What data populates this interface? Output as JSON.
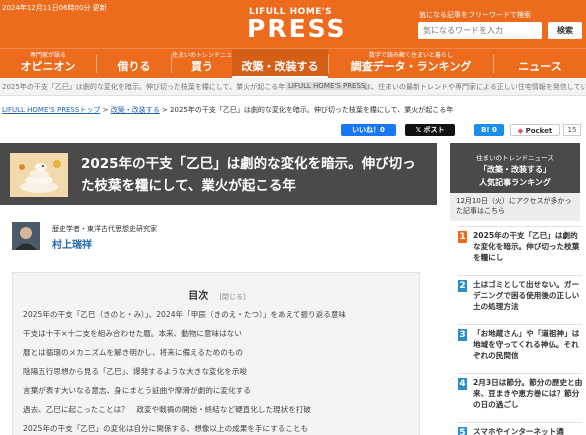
{
  "header": {
    "updated": "2024年12月11日06時00分 更新",
    "logo_top": "LIFULL HOME'S",
    "logo_main": "PRESS",
    "search_label": "気になる記事をフリーワードで検索",
    "search_placeholder": "気になるワードを入力",
    "search_button": "検索"
  },
  "nav": [
    {
      "sub": "専門家が語る",
      "label": "オピニオン"
    },
    {
      "sub": "",
      "label": "借りる"
    },
    {
      "sub": "住まいのトレンドニュース",
      "label": "買う"
    },
    {
      "sub": "",
      "label": "改築・改装する"
    },
    {
      "sub": "数字で読み解く住まいと暮らし",
      "label": "調査データ・ランキング"
    },
    {
      "sub": "",
      "label": "ニュース"
    }
  ],
  "ticker": {
    "left": "2025年の干支「乙巳」は劇的な変化を暗示。伸び切った枝葉を糧にして、業火が起こる年",
    "highlight": "LIFULL HOME'S PRESS",
    "right": "は、住まいの最新トレンドや専門家による正しい住宅情報を発信してい"
  },
  "breadcrumb": {
    "home": "LIFULL HOME'S PRESSトップ",
    "category": "改築・改装する",
    "current": "2025年の干支「乙巳」は劇的な変化を暗示。伸び切った枝葉を糧にして、業火が起こる年"
  },
  "share": {
    "facebook": "いいね！0",
    "x": "ポスト",
    "hatena": "B! 0",
    "pocket": "Pocket",
    "pocket_count": "15"
  },
  "article": {
    "title_line1": "2025年の干支「乙巳」は劇的な変化を暗示。伸び切っ",
    "title_line2": "た枝葉を糧にして、業火が起こる年",
    "author_title": "歴史学者・東洋古代思想史研究家",
    "author_name": "村上瑞祥"
  },
  "toc": {
    "title": "目次",
    "close": "[閉じる]",
    "items": [
      "2025年の干支「乙巳（きのと・み）」、2024年「甲辰（きのえ・たつ）」をあえて振り返る意味",
      "干支は十干×十二支を組み合わせた暦。本来、動物に意味はない",
      "暦とは循環のメカニズムを解き明かし、将来に備えるためのもの",
      "陰陽五行思想から見る「乙巳」、爆発するような大きな変化を示唆",
      "言葉が表す大いなる意志、身にまとう証曲や摩滑が劇的に変化する",
      "過去、乙巳に起こったことは？　政変や戦禍の開始・終結など硬直化した現状を打破",
      "2025年の干支「乙巳」の変化は自分に関係する、想像以上の成果を手にすることも"
    ]
  },
  "sidebar": {
    "header_sub": "住まいのトレンドニュース",
    "header_cat": "「改築・改装する」",
    "header_title": "人気記事ランキング",
    "subheader": "12月10日（火）にアクセスが多かった記事はこちら",
    "ranking": [
      {
        "num": "1",
        "text": "2025年の干支「乙巳」は劇的な変化を暗示。伸び切った枝葉を糧にし",
        "color": "#ed6b1d"
      },
      {
        "num": "2",
        "text": "土はゴミとして出せない。ガーデニングで困る使用後の正しい土の処理方法",
        "color": "#2a8fc8"
      },
      {
        "num": "3",
        "text": "「お地蔵さん」や「道祖神」は地域を守ってくれる神仏。それぞれの民間信",
        "color": "#2a8fc8"
      },
      {
        "num": "4",
        "text": "2月3日は節分。節分の歴史と由来、豆まきや恵方巻には？節分の日の過ごし",
        "color": "#2a8fc8"
      },
      {
        "num": "5",
        "text": "スマホやインターネット通",
        "color": "#2a8fc8"
      }
    ]
  }
}
